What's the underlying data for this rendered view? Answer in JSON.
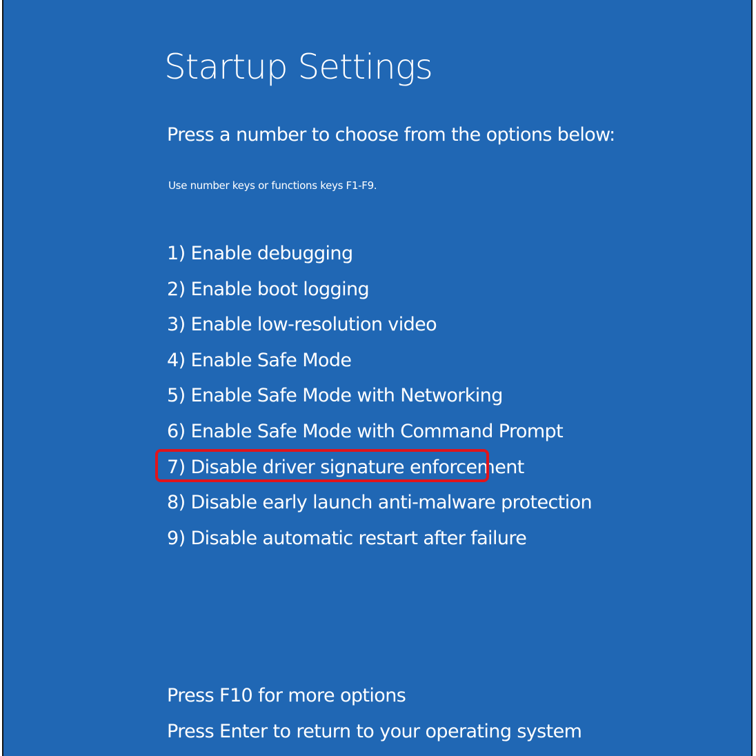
{
  "screen": {
    "title": "Startup Settings",
    "instruction": "Press a number to choose from the options below:",
    "hint": "Use number keys or functions keys F1-F9.",
    "options": [
      "1) Enable debugging",
      "2) Enable boot logging",
      "3) Enable low-resolution video",
      "4) Enable Safe Mode",
      "5) Enable Safe Mode with Networking",
      "6) Enable Safe Mode with Command Prompt",
      "7) Disable driver signature enforcement",
      "8) Disable early launch anti-malware protection",
      "9) Disable automatic restart after failure"
    ],
    "highlighted_option_index": 7,
    "footer": {
      "more_options": "Press F10 for more options",
      "return": "Press Enter to return to your operating system"
    }
  },
  "colors": {
    "background": "#2067b4",
    "text": "#ffffff",
    "highlight_border": "#e1141b"
  }
}
